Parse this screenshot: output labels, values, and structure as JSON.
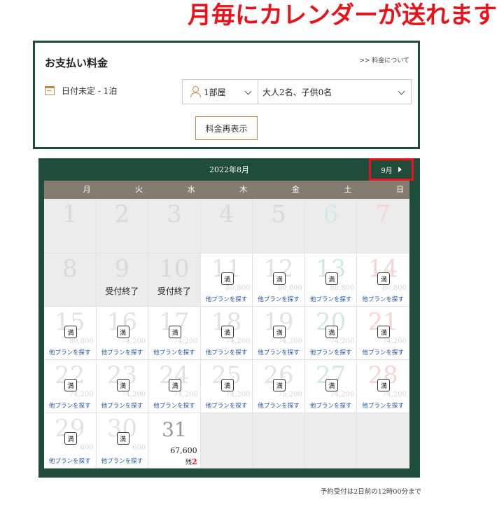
{
  "headline": "月毎にカレンダーが送れます",
  "payment": {
    "title": "お支払い料金",
    "fee_link": ">> 料金について",
    "date_text": "日付未定 - 1泊",
    "room_select": "1部屋",
    "guest_select": "大人2名、子供0名",
    "redisplay_button": "料金再表示"
  },
  "calendar": {
    "month_label": "2022年8月",
    "next_month_label": "9月",
    "weekdays": [
      "月",
      "火",
      "水",
      "木",
      "金",
      "土",
      "日"
    ],
    "full_label": "満",
    "plan_label": "他プランを探す",
    "closed_label": "受付終了",
    "remaining_label": "残",
    "days": [
      {
        "day": "1",
        "state": "past"
      },
      {
        "day": "2",
        "state": "past"
      },
      {
        "day": "3",
        "state": "past"
      },
      {
        "day": "4",
        "state": "past"
      },
      {
        "day": "5",
        "state": "past"
      },
      {
        "day": "6",
        "state": "past",
        "weekend": "sat"
      },
      {
        "day": "7",
        "state": "past",
        "weekend": "sun"
      },
      {
        "day": "8",
        "state": "past"
      },
      {
        "day": "9",
        "state": "closed"
      },
      {
        "day": "10",
        "state": "closed"
      },
      {
        "day": "11",
        "state": "full",
        "price": "80,800"
      },
      {
        "day": "12",
        "state": "full",
        "price": "80,800"
      },
      {
        "day": "13",
        "state": "full",
        "price": "80,800",
        "weekend": "sat"
      },
      {
        "day": "14",
        "state": "full",
        "price": "80,800",
        "weekend": "sun"
      },
      {
        "day": "15",
        "state": "full",
        "price": "80,800"
      },
      {
        "day": "16",
        "state": "full",
        "price": "74,200"
      },
      {
        "day": "17",
        "state": "full",
        "price": "74,200"
      },
      {
        "day": "18",
        "state": "full",
        "price": "74,200"
      },
      {
        "day": "19",
        "state": "full",
        "price": "74,200"
      },
      {
        "day": "20",
        "state": "full",
        "price": "74,200",
        "weekend": "sat"
      },
      {
        "day": "21",
        "state": "full",
        "price": "74,200",
        "weekend": "sun"
      },
      {
        "day": "22",
        "state": "full",
        "price": "74,200"
      },
      {
        "day": "23",
        "state": "full",
        "price": "74,200"
      },
      {
        "day": "24",
        "state": "full",
        "price": "74,200"
      },
      {
        "day": "25",
        "state": "full",
        "price": "74,200"
      },
      {
        "day": "26",
        "state": "full",
        "price": "75,200"
      },
      {
        "day": "27",
        "state": "full",
        "price": "74,200",
        "weekend": "sat"
      },
      {
        "day": "28",
        "state": "full",
        "price": "74,200",
        "weekend": "sun"
      },
      {
        "day": "29",
        "state": "full",
        "price": "600"
      },
      {
        "day": "30",
        "state": "full",
        "price": "600"
      },
      {
        "day": "31",
        "state": "available",
        "price": "67,600",
        "remaining": "2"
      },
      {
        "state": "blank"
      },
      {
        "state": "blank"
      },
      {
        "state": "blank"
      },
      {
        "state": "blank"
      }
    ]
  },
  "footnote": "予約受付は2日前の12時00分まで",
  "colors": {
    "headline": "#e8131b",
    "frame_green": "#1f4c3b",
    "weekday_bar": "#857b6f",
    "plan_link": "#2156a5",
    "highlight_box": "#e8131b"
  }
}
